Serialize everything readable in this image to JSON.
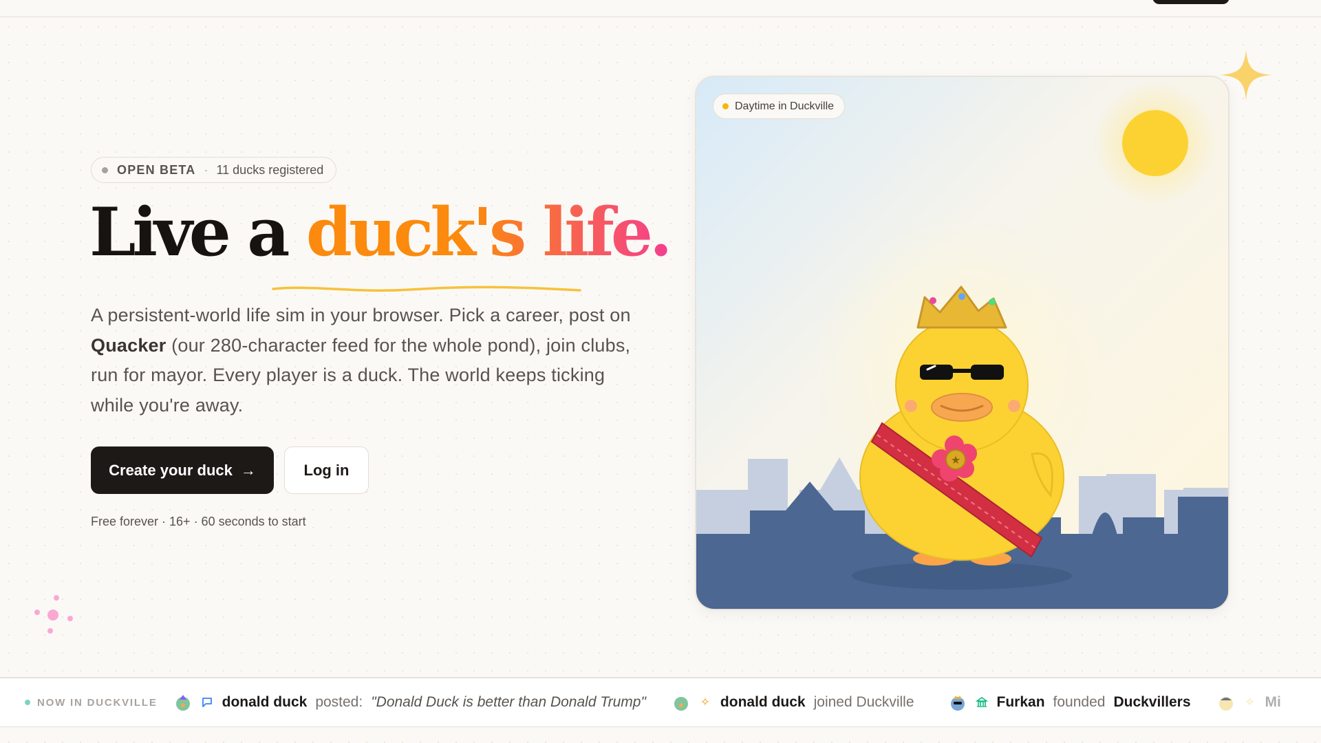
{
  "badge": {
    "status": "OPEN BETA",
    "separator": "·",
    "registered": "11 ducks registered"
  },
  "headline": {
    "part1": "Live a ",
    "part2": "duck's life."
  },
  "description": {
    "before": "A persistent-world life sim in your browser. Pick a career, post on ",
    "brand": "Quacker",
    "after": " (our 280-character feed for the whole pond), join clubs, run for mayor. Every player is a duck. The world keeps ticking while you're away."
  },
  "cta": {
    "primary_label": "Create your duck",
    "primary_arrow": "→",
    "secondary_label": "Log in"
  },
  "fineprint": "Free forever · 16+ · 60 seconds to start",
  "card": {
    "status_pill": "Daytime in Duckville"
  },
  "ticker": {
    "label": "NOW IN DUCKVILLE",
    "items": [
      {
        "icon": "chat-bubble-icon",
        "actor": "donald duck",
        "verb": "posted:",
        "text": "\"Donald Duck is better than Donald Trump\""
      },
      {
        "icon": "sparkle-icon",
        "actor": "donald duck",
        "verb": "joined Duckville",
        "text": ""
      },
      {
        "icon": "bank-icon",
        "actor": "Furkan",
        "verb": "founded",
        "text": "Duckvillers"
      },
      {
        "icon": "sparkle-icon",
        "actor": "Mi",
        "verb": "",
        "text": ""
      }
    ]
  },
  "colors": {
    "accent_orange": "#fb8a0e",
    "accent_pink": "#f43f8e",
    "dark": "#1c1917",
    "sky_ground": "#4b6792",
    "sun": "#fcd233"
  }
}
